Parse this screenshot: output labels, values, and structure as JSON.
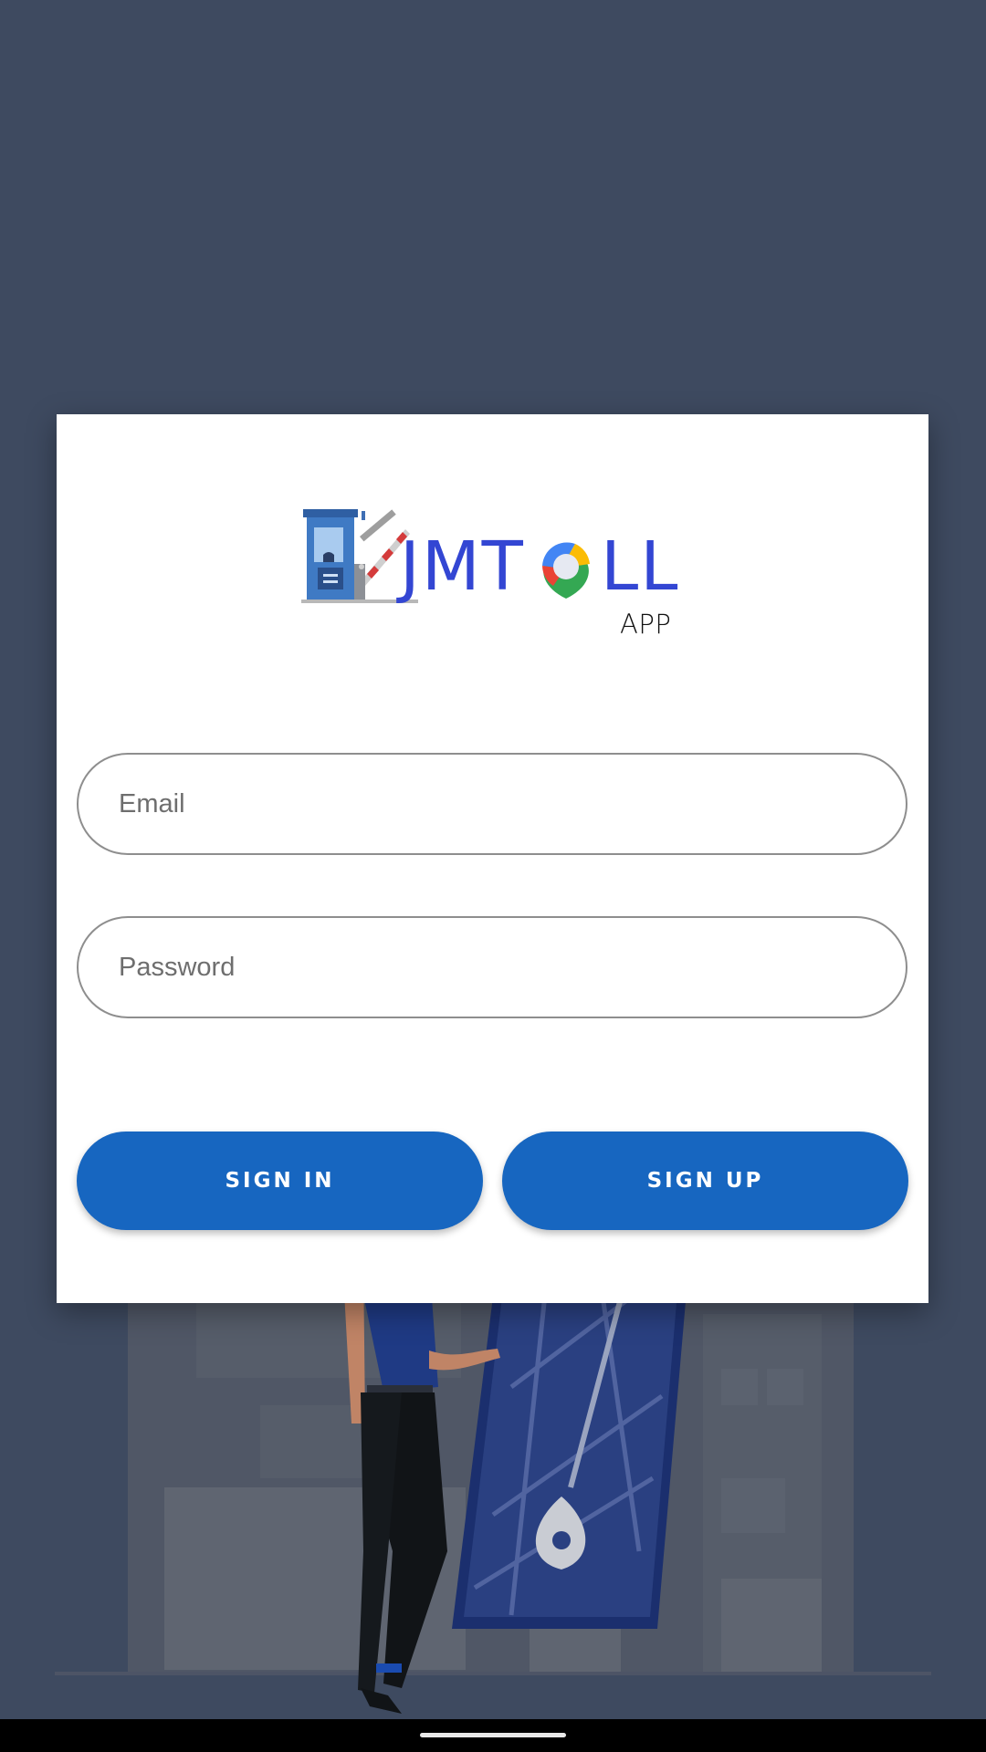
{
  "app": {
    "name": "JMTOLL",
    "subtitle": "APP"
  },
  "colors": {
    "background": "#3e4a60",
    "card": "#ffffff",
    "primary_button": "#1766c0",
    "logo_text": "#3346d3",
    "field_border": "#8e8e8e"
  },
  "form": {
    "email": {
      "placeholder": "Email",
      "value": ""
    },
    "password": {
      "placeholder": "Password",
      "value": ""
    }
  },
  "buttons": {
    "sign_in": "SIGN IN",
    "sign_up": "SIGN UP"
  },
  "icons": {
    "logo_booth": "toll-booth-icon",
    "logo_pin": "map-pin-icon",
    "home_handle": "gesture-handle"
  }
}
